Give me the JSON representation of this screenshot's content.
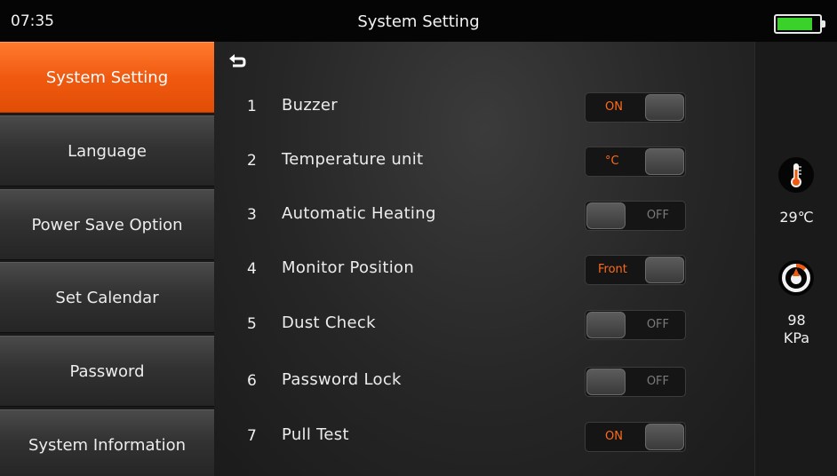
{
  "status_bar": {
    "time": "07:35",
    "title": "System Setting",
    "battery_level": 0.85,
    "battery_color": "#39d12a"
  },
  "sidebar": {
    "items": [
      {
        "label": "System Setting",
        "active": true
      },
      {
        "label": "Language",
        "active": false
      },
      {
        "label": "Power Save Option",
        "active": false
      },
      {
        "label": "Set Calendar",
        "active": false
      },
      {
        "label": "Password",
        "active": false
      },
      {
        "label": "System Information",
        "active": false
      }
    ],
    "active_color": "#f05a10"
  },
  "settings": {
    "back_icon": "back-arrow-icon",
    "rows": [
      {
        "num": "1",
        "label": "Buzzer",
        "state": "on",
        "value": "ON"
      },
      {
        "num": "2",
        "label": "Temperature unit",
        "state": "on",
        "value": "°C"
      },
      {
        "num": "3",
        "label": "Automatic Heating",
        "state": "off",
        "value": "OFF"
      },
      {
        "num": "4",
        "label": "Monitor Position",
        "state": "on",
        "value": "Front"
      },
      {
        "num": "5",
        "label": "Dust Check",
        "state": "off",
        "value": "OFF"
      },
      {
        "num": "6",
        "label": "Password Lock",
        "state": "off",
        "value": "OFF"
      },
      {
        "num": "7",
        "label": "Pull Test",
        "state": "on",
        "value": "ON"
      }
    ],
    "on_color": "#ff6a1a"
  },
  "gauges": {
    "temperature": {
      "icon": "thermometer-icon",
      "value": "29℃"
    },
    "pressure": {
      "icon": "pressure-gauge-icon",
      "value": "98",
      "unit": "KPa"
    }
  }
}
